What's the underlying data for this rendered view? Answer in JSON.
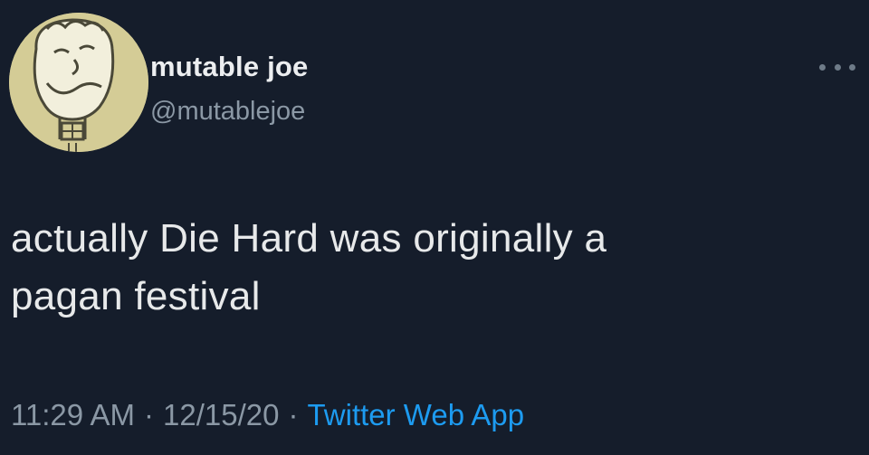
{
  "tweet": {
    "author": {
      "display_name": "mutable joe",
      "handle": "@mutablejoe",
      "avatar_icon": "cartoon-face-avatar"
    },
    "more_icon": "more-horizontal-icon",
    "text_lines": [
      "actually Die Hard was originally a",
      "pagan festival"
    ],
    "meta": {
      "time": "11:29 AM",
      "separator": "·",
      "date": "12/15/20",
      "source": "Twitter Web App"
    }
  },
  "colors": {
    "background": "#151d2b",
    "text_primary": "#e7e9ea",
    "text_secondary": "#8b98a5",
    "link": "#1d9bf0",
    "avatar_bg": "#d4cc96"
  }
}
